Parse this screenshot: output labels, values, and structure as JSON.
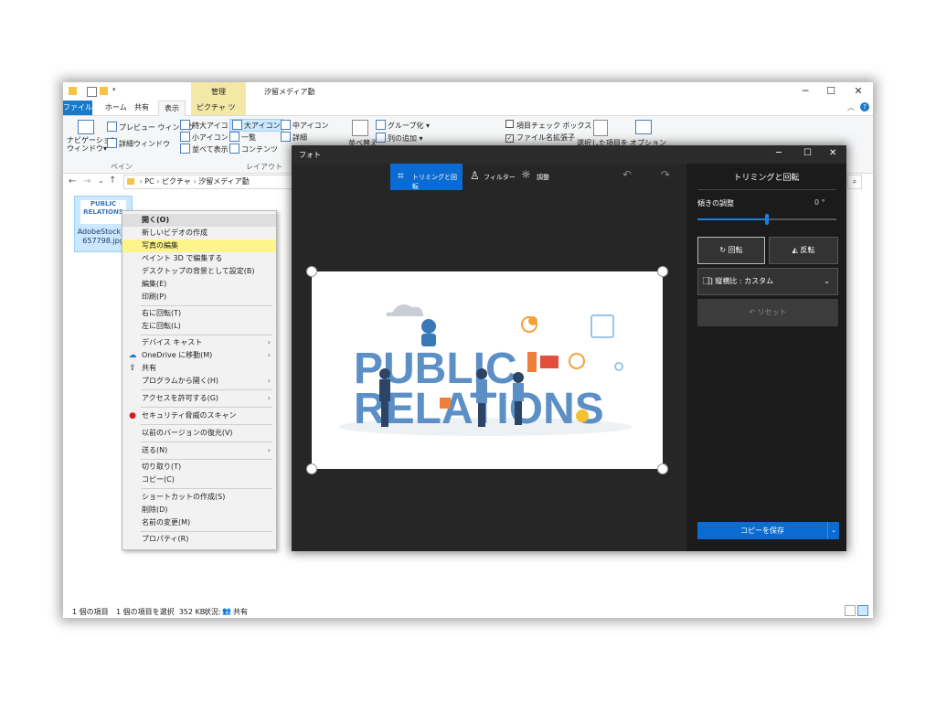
{
  "explorer": {
    "manage_tab": "管理",
    "window_title": "汐留メディア勤",
    "ribbon_tabs": [
      "ファイル",
      "ホーム",
      "共有",
      "表示",
      "ピクチャ ツール"
    ],
    "pane": {
      "nav_pane": "ナビゲーション\nウィンドウ▾",
      "preview": "プレビュー ウィンドウ",
      "details": "詳細ウィンドウ",
      "group": "ペイン"
    },
    "layout": {
      "xl_icons": "特大アイコン",
      "large_icons": "大アイコン",
      "medium_icons": "中アイコン",
      "small_icons": "小アイコン",
      "list": "一覧",
      "details": "詳細",
      "tiles": "並べて表示",
      "content": "コンテンツ",
      "group": "レイアウト"
    },
    "view": {
      "sort": "並べ替え",
      "group_by": "グループ化 ▾",
      "add_columns": "列の追加 ▾",
      "item_checkbox": "項目チェック ボックス",
      "file_ext": "ファイル名拡張子",
      "hide_selected": "選択した項目を",
      "options": "オプション"
    },
    "address": {
      "path": [
        "PC",
        "ピクチャ",
        "汐留メディア勤"
      ]
    },
    "file": {
      "thumb_line1": "PUBLIC",
      "thumb_line2": "RELATIONS",
      "name_line1": "AdobeStock_2",
      "name_line2": "657798.jpg"
    },
    "status": {
      "count": "1 個の項目",
      "selected": "1 個の項目を選択  352 KB",
      "state_label": "状況:",
      "state_value": "共有"
    }
  },
  "context_menu": {
    "items": [
      {
        "label": "開く(O)"
      },
      {
        "label": "新しいビデオの作成"
      },
      {
        "label": "写真の編集"
      },
      {
        "label": "ペイント 3D で編集する"
      },
      {
        "label": "デスクトップの背景として設定(B)"
      },
      {
        "label": "編集(E)"
      },
      {
        "label": "印刷(P)"
      },
      {
        "label": "右に回転(T)"
      },
      {
        "label": "左に回転(L)"
      },
      {
        "label": "デバイス キャスト"
      },
      {
        "label": "OneDrive に移動(M)"
      },
      {
        "label": "共有"
      },
      {
        "label": "プログラムから開く(H)"
      },
      {
        "label": "アクセスを許可する(G)"
      },
      {
        "label": "セキュリティ脅威のスキャン"
      },
      {
        "label": "以前のバージョンの復元(V)"
      },
      {
        "label": "送る(N)"
      },
      {
        "label": "切り取り(T)"
      },
      {
        "label": "コピー(C)"
      },
      {
        "label": "ショートカットの作成(S)"
      },
      {
        "label": "削除(D)"
      },
      {
        "label": "名前の変更(M)"
      },
      {
        "label": "プロパティ(R)"
      }
    ]
  },
  "photos": {
    "title": "フォト",
    "toolbar": {
      "crop": "トリミングと回転",
      "filter": "フィルター",
      "adjust": "調整"
    },
    "image": {
      "line1": "PUBLIC",
      "line2": "RELATIONS"
    },
    "panel": {
      "title": "トリミングと回転",
      "tilt_label": "傾きの調整",
      "tilt_value": "0 °",
      "tilt_level": 0.5,
      "rotate": "回転",
      "flip": "反転",
      "aspect": "縦横比 : カスタム",
      "reset": "リセット",
      "save": "コピーを保存"
    }
  },
  "colors": {
    "accent": "#0a6cd2",
    "highlight": "#fdf58a",
    "explorer_accent": "#1979ca"
  }
}
